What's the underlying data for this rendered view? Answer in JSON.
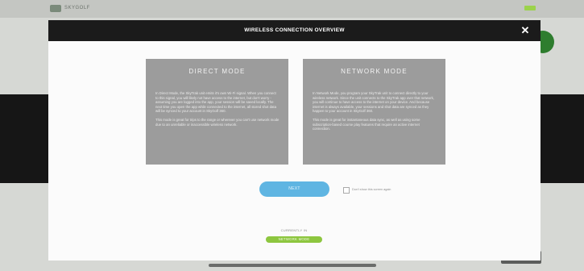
{
  "app": {
    "brand_label": "SKYGOLF",
    "colors": {
      "accent_blue": "#5fb5e2",
      "accent_green": "#8dc63f",
      "panel_gray": "#9c9c9c",
      "header_dark": "#1b1b1b"
    }
  },
  "modal": {
    "title": "WIRELESS CONNECTION OVERVIEW",
    "close_icon": "close-icon",
    "close_label": "✕",
    "panels": [
      {
        "title": "DIRECT MODE",
        "paragraphs": [
          "In Direct Mode, the SkyTrak unit emits it's own Wi-Fi signal. When you connect to this signal, you will likely not have access to the internet, but don't worry - assuming you are logged into the app, your session will be saved locally. The next time you open the app while connected to the internet, all stored shot data will be synced to your account in SkyGolf 360.",
          "This mode is great for trips to the range or wherever you can't use network mode due to an unreliable or inaccessible wireless network."
        ]
      },
      {
        "title": "NETWORK MODE",
        "paragraphs": [
          "In Network Mode, you program your SkyTrak unit to connect directly to your wireless network. Since the unit connects to the SkyTrak app over that network, you will continue to have access to the internet on your device. And because internet is always available, your sessions and shot data are synced as they happen to your account in SkyGolf 360.",
          "This mode is great for instantaneous data sync, as well as using some subscription-based course play features that require an active internet connection."
        ]
      }
    ],
    "next_button": "NEXT",
    "dont_show_label": "Don't show this screen again",
    "currently_in_label": "CURRENTLY IN",
    "current_mode": "NETWORK MODE"
  }
}
